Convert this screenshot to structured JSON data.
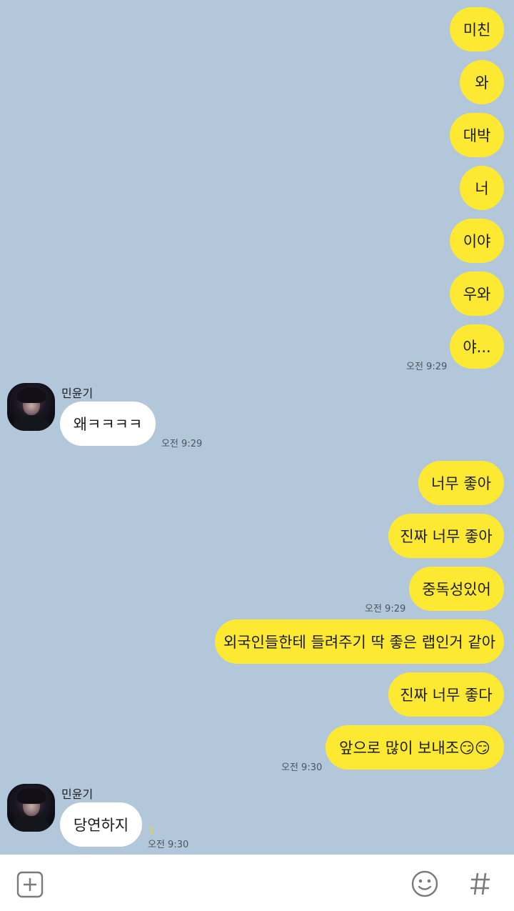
{
  "messages_top": [
    {
      "text": "미친"
    },
    {
      "text": "와"
    },
    {
      "text": "대박"
    },
    {
      "text": "너"
    },
    {
      "text": "이야"
    },
    {
      "text": "우와"
    },
    {
      "text": "야..."
    }
  ],
  "time_a": "오전 9:29",
  "reply1": {
    "sender": "민윤기",
    "text": "왜ㅋㅋㅋㅋ",
    "time": "오전 9:29"
  },
  "messages_mid": [
    {
      "text": "너무 좋아"
    },
    {
      "text": "진짜 너무 좋아"
    },
    {
      "text": "중독성있어"
    }
  ],
  "time_b": "오전 9:29",
  "messages_low": [
    {
      "text": "외국인들한테 들려주기 딱 좋은 랩인거 같아"
    },
    {
      "text": "진짜 너무 좋다"
    },
    {
      "text": "앞으로 많이 보내조😏😏"
    }
  ],
  "time_c": "오전 9:30",
  "reply2": {
    "sender": "민윤기",
    "text": "당연하지",
    "time": "오전 9:30",
    "unread": "1"
  },
  "toolbar": {
    "plus_icon": "plus-square-icon",
    "emoji_icon": "smiley-icon",
    "hash_icon": "hash-icon"
  },
  "colors": {
    "background": "#b2c7da",
    "my_bubble": "#fee932",
    "their_bubble": "#ffffff"
  }
}
